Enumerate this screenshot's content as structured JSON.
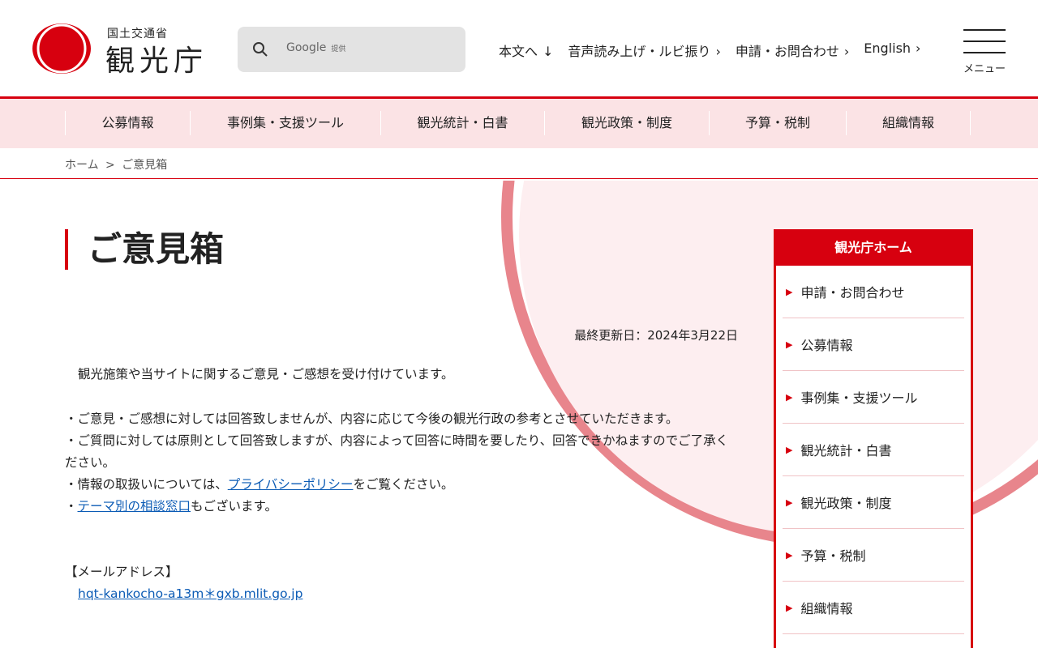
{
  "header": {
    "ministry": "国土交通省",
    "agency": "観光庁",
    "search_placeholder": "Google",
    "search_provider": "提供",
    "links": [
      "本文へ",
      "音声読み上げ・ルビ振り",
      "申請・お問合わせ",
      "English"
    ],
    "menu_label": "メニュー"
  },
  "gnav": [
    "公募情報",
    "事例集・支援ツール",
    "観光統計・白書",
    "観光政策・制度",
    "予算・税制",
    "組織情報"
  ],
  "breadcrumb": {
    "home": "ホーム",
    "sep": ">",
    "current": "ご意見箱"
  },
  "main": {
    "title": "ご意見箱",
    "updated": "最終更新日：2024年3月22日",
    "intro": "観光施策や当サイトに関するご意見・ご感想を受け付けています。",
    "b1": "・ご意見・ご感想に対しては回答致しませんが、内容に応じて今後の観光行政の参考とさせていただきます。",
    "b2": "・ご質問に対しては原則として回答致しますが、内容によって回答に時間を要したり、回答できかねますのでご了承ください。",
    "b3_pre": "・情報の取扱いについては、",
    "b3_link": "プライバシーポリシー",
    "b3_post": "をご覧ください。",
    "b4_pre": "・",
    "b4_link": "テーマ別の相談窓口",
    "b4_post": "もございます。",
    "mail_label": "【メールアドレス】",
    "mail": "hqt-kankocho-a13m＊gxb.mlit.go.jp"
  },
  "side": {
    "title": "観光庁ホーム",
    "items": [
      "申請・お問合わせ",
      "公募情報",
      "事例集・支援ツール",
      "観光統計・白書",
      "観光政策・制度",
      "予算・税制",
      "組織情報"
    ]
  },
  "colors": {
    "accent": "#d7000f",
    "nav_bg": "#fbe3e5",
    "link": "#0b5bb5"
  }
}
